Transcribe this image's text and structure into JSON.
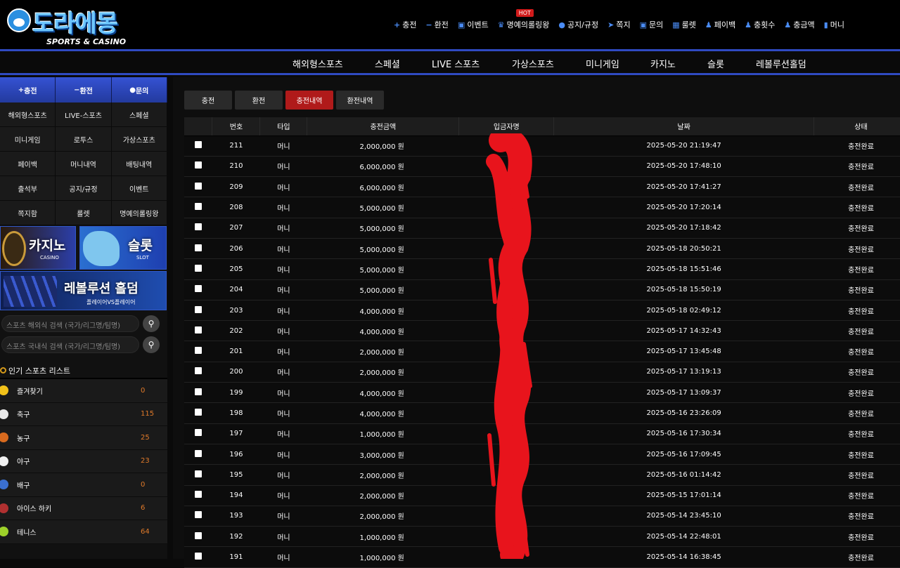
{
  "logo": {
    "text": "도라에몽",
    "sub": "SPORTS & CASINO"
  },
  "topmenu": [
    {
      "icon": "plus-icon",
      "glyph": "+",
      "label": "충전"
    },
    {
      "icon": "minus-icon",
      "glyph": "−",
      "label": "환전"
    },
    {
      "icon": "calendar-icon",
      "glyph": "▣",
      "label": "이벤트"
    },
    {
      "icon": "trophy-icon",
      "glyph": "♛",
      "label": "명예의롤링왕",
      "badge": "HOT"
    },
    {
      "icon": "info-icon",
      "glyph": "●",
      "label": "공지/규정"
    },
    {
      "icon": "send-icon",
      "glyph": "➤",
      "label": "쪽지"
    },
    {
      "icon": "question-icon",
      "glyph": "▣",
      "label": "문의"
    },
    {
      "icon": "gift-icon",
      "glyph": "▦",
      "label": "룰렛"
    },
    {
      "icon": "payback-icon",
      "glyph": "♟",
      "label": "페이백"
    },
    {
      "icon": "count-icon",
      "glyph": "♟",
      "label": "충횟수"
    },
    {
      "icon": "amount-icon",
      "glyph": "♟",
      "label": "충금액"
    },
    {
      "icon": "money-icon",
      "glyph": "▮",
      "label": "머니"
    }
  ],
  "nav": [
    "해외형스포츠",
    "스페셜",
    "LIVE 스포츠",
    "가상스포츠",
    "미니게임",
    "카지노",
    "슬롯",
    "레볼루션홀덤"
  ],
  "sidebar": {
    "top_buttons": [
      {
        "glyph": "+",
        "label": "충전"
      },
      {
        "glyph": "−",
        "label": "환전"
      },
      {
        "glyph": "●",
        "label": "문의"
      }
    ],
    "grid": [
      "해외형스포츠",
      "LIVE-스포츠",
      "스페셜",
      "미니게임",
      "로투스",
      "가상스포츠",
      "페이백",
      "머니내역",
      "배팅내역",
      "출석부",
      "공지/규정",
      "이벤트",
      "쪽지함",
      "룰렛",
      "명예의롤링왕"
    ],
    "banners": {
      "casino": "카지노",
      "casino_sub": "CASINO",
      "slot": "슬롯",
      "slot_sub": "SLOT",
      "holdem": "레볼루션 홀덤",
      "holdem_sub": "플레이어VS플레이어"
    },
    "search": [
      {
        "placeholder": "스포츠 해외식 검색 (국가/리그명/팀명)"
      },
      {
        "placeholder": "스포츠 국내식 검색 (국가/리그명/팀명)"
      }
    ],
    "popular_title": "인기 스포츠 리스트",
    "sports": [
      {
        "name": "즐겨찾기",
        "count": "0",
        "icon": "star-icon",
        "color": "#f2c21a"
      },
      {
        "name": "축구",
        "count": "115",
        "icon": "soccer-icon",
        "color": "#e8e8e8"
      },
      {
        "name": "농구",
        "count": "25",
        "icon": "basketball-icon",
        "color": "#d86a1e"
      },
      {
        "name": "야구",
        "count": "23",
        "icon": "baseball-icon",
        "color": "#f0f0f0"
      },
      {
        "name": "배구",
        "count": "0",
        "icon": "volleyball-icon",
        "color": "#3a6fd0"
      },
      {
        "name": "아이스 하키",
        "count": "6",
        "icon": "hockey-icon",
        "color": "#b03030"
      },
      {
        "name": "테니스",
        "count": "64",
        "icon": "tennis-icon",
        "color": "#9ed12a"
      }
    ]
  },
  "tabs": [
    {
      "label": "충전",
      "active": false
    },
    {
      "label": "환전",
      "active": false
    },
    {
      "label": "충전내역",
      "active": true
    },
    {
      "label": "환전내역",
      "active": false
    }
  ],
  "table": {
    "headers": [
      "",
      "번호",
      "타입",
      "충전금액",
      "입금자명",
      "날짜",
      "상태"
    ],
    "rows": [
      [
        "211",
        "머니",
        "2,000,000 원",
        "2025-05-20 21:19:47",
        "충전완료"
      ],
      [
        "210",
        "머니",
        "6,000,000 원",
        "2025-05-20 17:48:10",
        "충전완료"
      ],
      [
        "209",
        "머니",
        "6,000,000 원",
        "2025-05-20 17:41:27",
        "충전완료"
      ],
      [
        "208",
        "머니",
        "5,000,000 원",
        "2025-05-20 17:20:14",
        "충전완료"
      ],
      [
        "207",
        "머니",
        "5,000,000 원",
        "2025-05-20 17:18:42",
        "충전완료"
      ],
      [
        "206",
        "머니",
        "5,000,000 원",
        "2025-05-18 20:50:21",
        "충전완료"
      ],
      [
        "205",
        "머니",
        "5,000,000 원",
        "2025-05-18 15:51:46",
        "충전완료"
      ],
      [
        "204",
        "머니",
        "5,000,000 원",
        "2025-05-18 15:50:19",
        "충전완료"
      ],
      [
        "203",
        "머니",
        "4,000,000 원",
        "2025-05-18 02:49:12",
        "충전완료"
      ],
      [
        "202",
        "머니",
        "4,000,000 원",
        "2025-05-17 14:32:43",
        "충전완료"
      ],
      [
        "201",
        "머니",
        "2,000,000 원",
        "2025-05-17 13:45:48",
        "충전완료"
      ],
      [
        "200",
        "머니",
        "2,000,000 원",
        "2025-05-17 13:19:13",
        "충전완료"
      ],
      [
        "199",
        "머니",
        "4,000,000 원",
        "2025-05-17 13:09:37",
        "충전완료"
      ],
      [
        "198",
        "머니",
        "4,000,000 원",
        "2025-05-16 23:26:09",
        "충전완료"
      ],
      [
        "197",
        "머니",
        "1,000,000 원",
        "2025-05-16 17:30:34",
        "충전완료"
      ],
      [
        "196",
        "머니",
        "3,000,000 원",
        "2025-05-16 17:09:45",
        "충전완료"
      ],
      [
        "195",
        "머니",
        "2,000,000 원",
        "2025-05-16 01:14:42",
        "충전완료"
      ],
      [
        "194",
        "머니",
        "2,000,000 원",
        "2025-05-15 17:01:14",
        "충전완료"
      ],
      [
        "193",
        "머니",
        "2,000,000 원",
        "2025-05-14 23:45:10",
        "충전완료"
      ],
      [
        "192",
        "머니",
        "1,000,000 원",
        "2025-05-14 22:48:01",
        "충전완료"
      ],
      [
        "191",
        "머니",
        "1,000,000 원",
        "2025-05-14 16:38:45",
        "충전완료"
      ]
    ]
  },
  "colors": {
    "accent": "#2f4ac2",
    "active_tab": "#b01a1a",
    "redaction": "#e8141c",
    "count": "#e07a2a"
  }
}
